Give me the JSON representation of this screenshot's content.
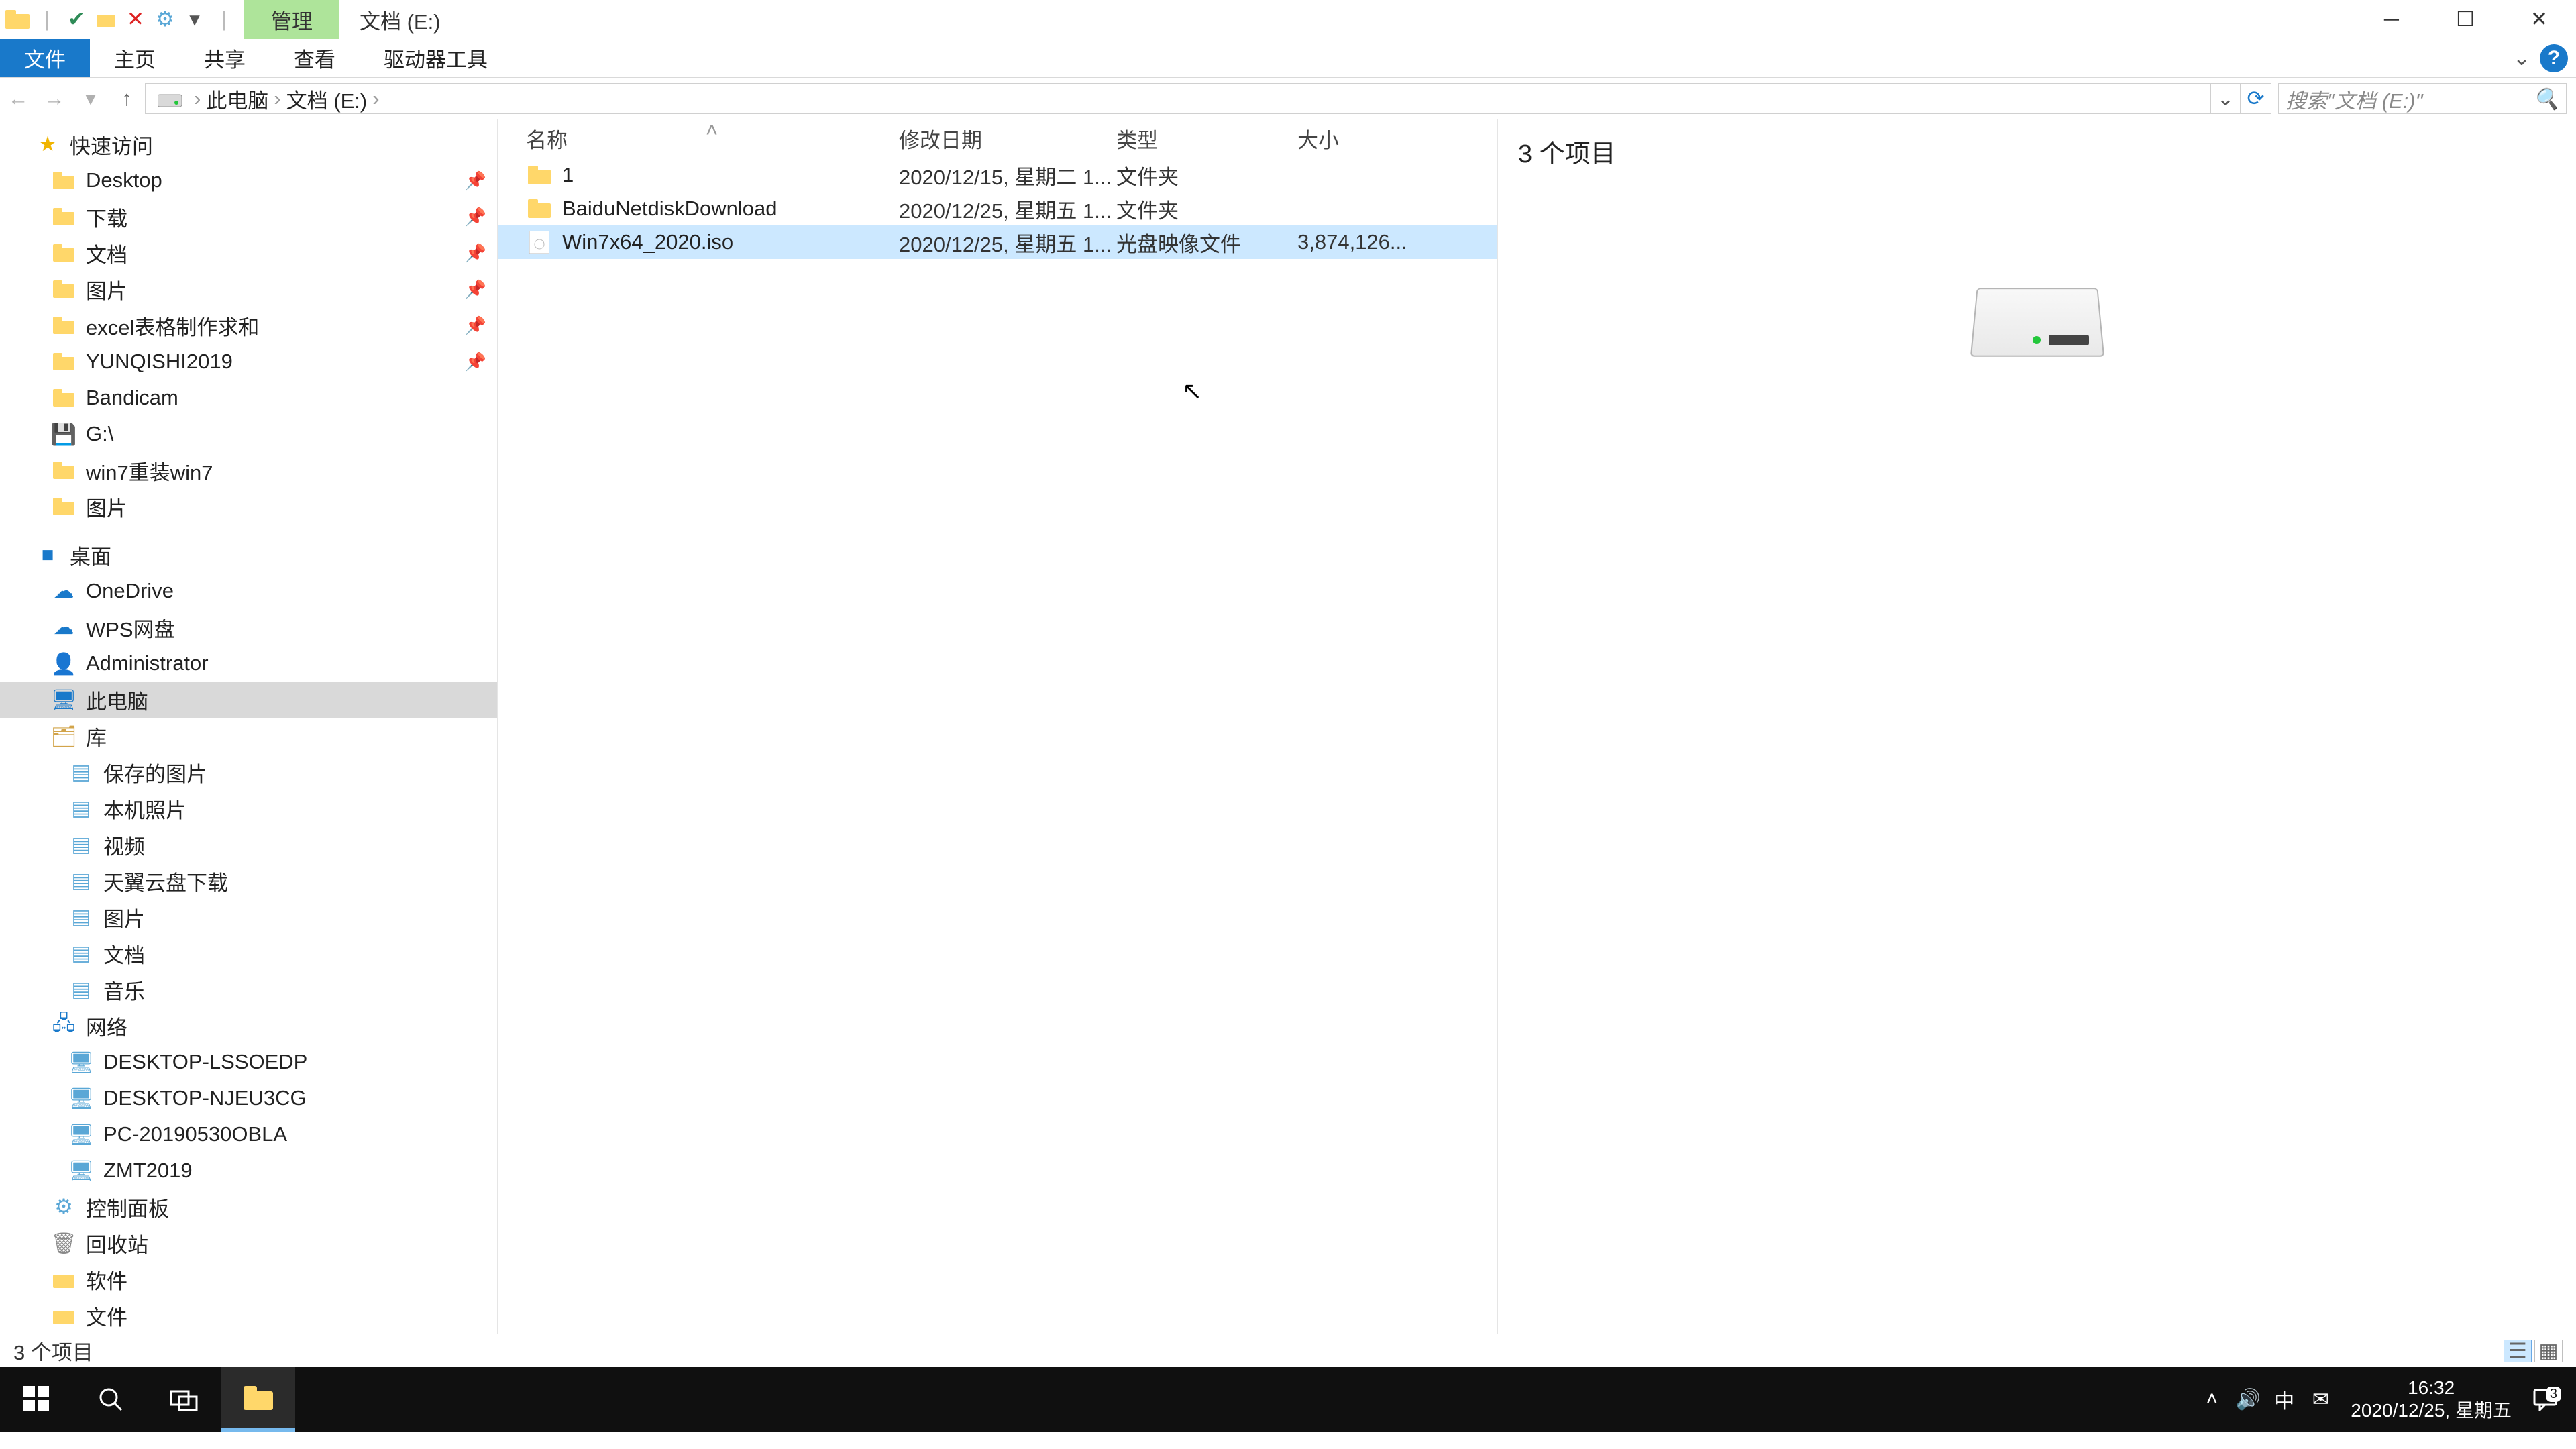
{
  "title": {
    "mgmt": "管理",
    "location": "文档 (E:)"
  },
  "ribbon": {
    "file": "文件",
    "home": "主页",
    "share": "共享",
    "view": "查看",
    "drive_tools": "驱动器工具"
  },
  "address": {
    "crumbs": [
      "此电脑",
      "文档 (E:)"
    ],
    "search_placeholder": "搜索\"文档 (E:)\""
  },
  "tree": {
    "quick": "快速访问",
    "quick_items": [
      {
        "label": "Desktop"
      },
      {
        "label": "下载"
      },
      {
        "label": "文档"
      },
      {
        "label": "图片"
      },
      {
        "label": "excel表格制作求和"
      },
      {
        "label": "YUNQISHI2019"
      },
      {
        "label": "Bandicam"
      },
      {
        "label": "G:\\"
      },
      {
        "label": "win7重装win7"
      },
      {
        "label": "图片"
      }
    ],
    "desktop": "桌面",
    "desktop_items": [
      {
        "label": "OneDrive"
      },
      {
        "label": "WPS网盘"
      },
      {
        "label": "Administrator"
      },
      {
        "label": "此电脑"
      },
      {
        "label": "库"
      }
    ],
    "lib_items": [
      {
        "label": "保存的图片"
      },
      {
        "label": "本机照片"
      },
      {
        "label": "视频"
      },
      {
        "label": "天翼云盘下载"
      },
      {
        "label": "图片"
      },
      {
        "label": "文档"
      },
      {
        "label": "音乐"
      }
    ],
    "network": "网络",
    "net_items": [
      {
        "label": "DESKTOP-LSSOEDP"
      },
      {
        "label": "DESKTOP-NJEU3CG"
      },
      {
        "label": "PC-20190530OBLA"
      },
      {
        "label": "ZMT2019"
      }
    ],
    "tail": [
      {
        "label": "控制面板"
      },
      {
        "label": "回收站"
      },
      {
        "label": "软件"
      },
      {
        "label": "文件"
      }
    ]
  },
  "columns": {
    "name": "名称",
    "date": "修改日期",
    "type": "类型",
    "size": "大小"
  },
  "rows": [
    {
      "name": "1",
      "date": "2020/12/15, 星期二 1...",
      "type": "文件夹",
      "size": "",
      "kind": "folder"
    },
    {
      "name": "BaiduNetdiskDownload",
      "date": "2020/12/25, 星期五 1...",
      "type": "文件夹",
      "size": "",
      "kind": "folder"
    },
    {
      "name": "Win7x64_2020.iso",
      "date": "2020/12/25, 星期五 1...",
      "type": "光盘映像文件",
      "size": "3,874,126...",
      "kind": "iso"
    }
  ],
  "preview": {
    "count_label": "3 个项目"
  },
  "status": {
    "count": "3 个项目"
  },
  "clock": {
    "time": "16:32",
    "date": "2020/12/25, 星期五"
  },
  "notif_badge": "3",
  "ime": "中"
}
